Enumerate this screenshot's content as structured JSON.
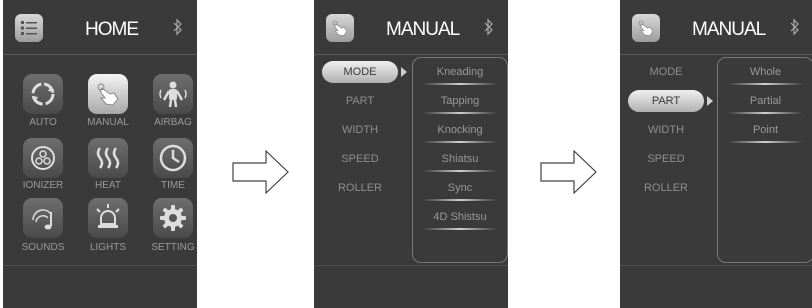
{
  "home": {
    "title": "HOME",
    "tiles": [
      {
        "label": "AUTO",
        "icon": "auto-cycle-icon"
      },
      {
        "label": "MANUAL",
        "icon": "hand-touch-icon"
      },
      {
        "label": "AIRBAG",
        "icon": "airbag-figure-icon"
      },
      {
        "label": "IONIZER",
        "icon": "ionizer-icon"
      },
      {
        "label": "HEAT",
        "icon": "heat-waves-icon"
      },
      {
        "label": "TIME",
        "icon": "clock-icon"
      },
      {
        "label": "SOUNDS",
        "icon": "music-note-icon"
      },
      {
        "label": "LIGHTS",
        "icon": "light-bulb-icon"
      },
      {
        "label": "SETTING",
        "icon": "gear-icon"
      }
    ]
  },
  "manual1": {
    "title": "MANUAL",
    "menu": [
      "MODE",
      "PART",
      "WIDTH",
      "SPEED",
      "ROLLER"
    ],
    "selected": "MODE",
    "options": [
      "Kneading",
      "Tapping",
      "Knocking",
      "Shiatsu",
      "Sync",
      "4D Shistsu"
    ]
  },
  "manual2": {
    "title": "MANUAL",
    "menu": [
      "MODE",
      "PART",
      "WIDTH",
      "SPEED",
      "ROLLER"
    ],
    "selected": "PART",
    "options": [
      "Whole",
      "Partial",
      "Point"
    ]
  },
  "colors": {
    "screen_bg": "#3a3a3a",
    "accent": "#e6e6e6",
    "text_dim": "#9a9a9a"
  }
}
